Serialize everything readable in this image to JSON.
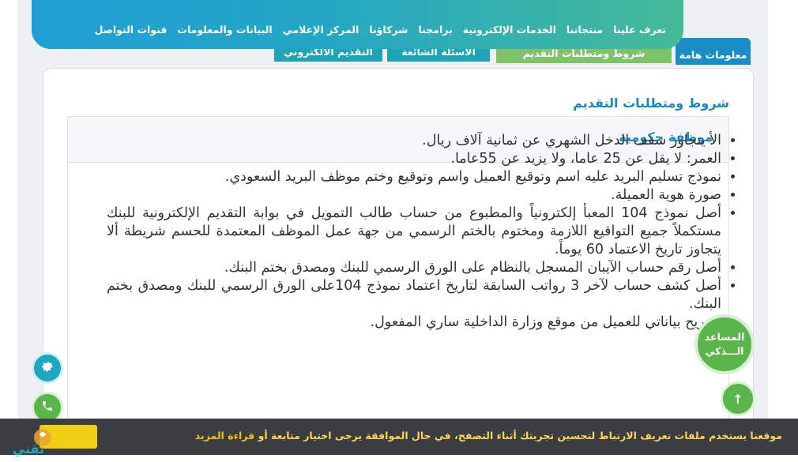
{
  "nav": {
    "items": [
      "تعرف علينا",
      "منتجاتنا",
      "الخدمات الإلكترونية",
      "برامجنا",
      "شركاؤنا",
      "المركز الإعلامي",
      "البيانات والمعلومات",
      "قنوات التواصل"
    ]
  },
  "tabs": {
    "items": [
      "معلومات هامة",
      "شروط ومتطلبات التقديم",
      "الأسئلة الشائعة",
      "التقديم الالكتروني"
    ]
  },
  "content": {
    "section_title": "شروط ومتطلبات التقديم",
    "panel_title": "موظفة حكومية",
    "requirements": [
      "الأ يتجاوز سقف الدخل الشهري عن ثمانية آلاف ريال.",
      "العمر: لا يقل عن  25  عاما، ولا يزيد عن 55عاما.",
      "نموذج تسليم البريد عليه اسم وتوقيع العميل واسم وتوقيع وختم موظف البريد السعودي.",
      "صورة هوية العميلة.",
      "أصل نموذج 104 المعبأ إلكترونياً والمطبوع من حساب طالب التمويل في بوابة التقديم الإلكترونية للبنك مستكملاً جميع التواقيع اللازمة ومختوم بالختم الرسمي من جهة عمل الموظف المعتمدة للحسم شريطة ألا يتجاوز تاريخ الاعتماد 60 يوماً.",
      "أصل رقم حساب الآيبان المسجل بالنظام على الورق الرسمي للبنك ومصدق بختم البنك.",
      "أصل كشف حساب لآخر  3  رواتب السابقة لتاريخ اعتماد نموذج  104على الورق الرسمي للبنك ومصدق بختم البنك.",
      "تصريح بياناتي للعميل من موقع وزارة الداخلية ساري المفعول."
    ]
  },
  "assistant": {
    "line1": "المساعد",
    "line2": "الـــذكي"
  },
  "cookie": {
    "text": "موقعنا يستخدم ملفات تعريف الارتباط لتحسين تجربتك أثناء التصفح، في حال الموافقة يرجى اختيار متابعة أو ",
    "more_label": "قراءة المزيد",
    "accept_label": ""
  },
  "logo": {
    "text": "تقني"
  }
}
